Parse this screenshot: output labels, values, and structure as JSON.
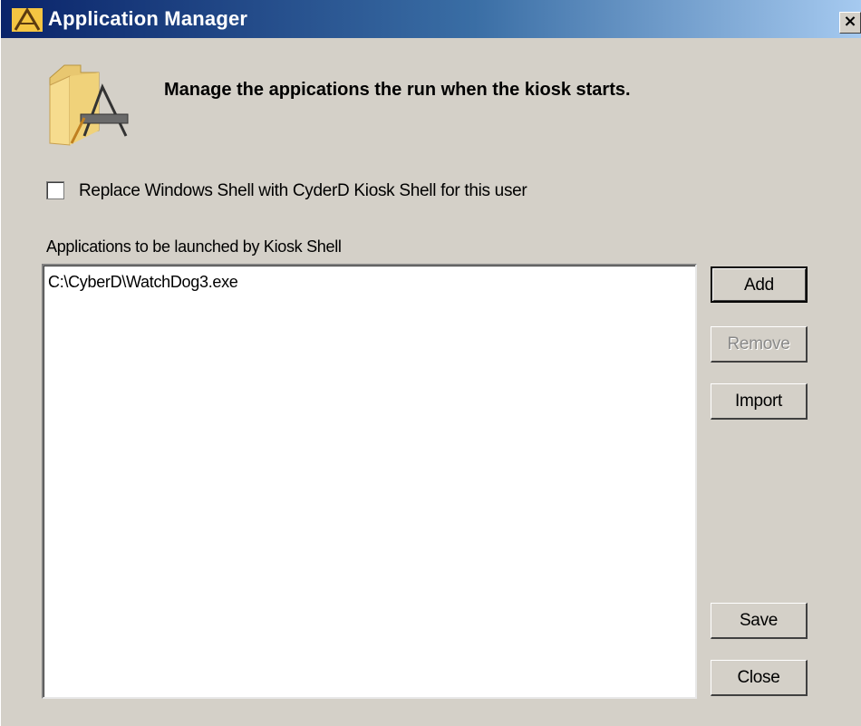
{
  "window": {
    "title": "Application Manager",
    "close_glyph": "×"
  },
  "header": {
    "icon": "folder-app-icon",
    "text": "Manage the appications the run when the kiosk starts."
  },
  "replace_shell": {
    "label": "Replace Windows Shell with CyderD Kiosk Shell for this user",
    "checked": false
  },
  "applications": {
    "label": "Applications to be launched by Kiosk Shell",
    "items": [
      "C:\\CyberD\\WatchDog3.exe"
    ]
  },
  "buttons": {
    "add": "Add",
    "remove": "Remove",
    "import": "Import",
    "save": "Save",
    "close": "Close"
  },
  "colors": {
    "titlebar_start": "#0a246a",
    "titlebar_end": "#a6caf0",
    "dialog_bg": "#d4d0c8"
  }
}
